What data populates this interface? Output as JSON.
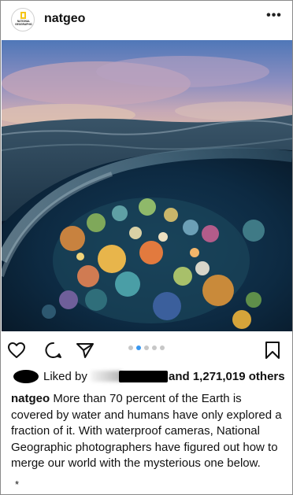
{
  "post": {
    "username": "natgeo",
    "more_label": "•••",
    "avatar_text": [
      "NATIONAL",
      "GEOGRAPHIC"
    ],
    "carousel": {
      "count": 5,
      "active_index": 1
    },
    "likes": {
      "prefix": "Liked by",
      "and_text": "and",
      "count": "1,271,019",
      "suffix": "others"
    },
    "caption": {
      "user": "natgeo",
      "text": "More than 70 percent of the Earth is covered by water and humans have only explored a fraction of it. With waterproof cameras, National Geographic photographers have figured out how to merge our world with the mysterious one below."
    },
    "footnote": "*",
    "icons": [
      "heart-icon",
      "comment-icon",
      "share-icon",
      "bookmark-icon"
    ]
  }
}
